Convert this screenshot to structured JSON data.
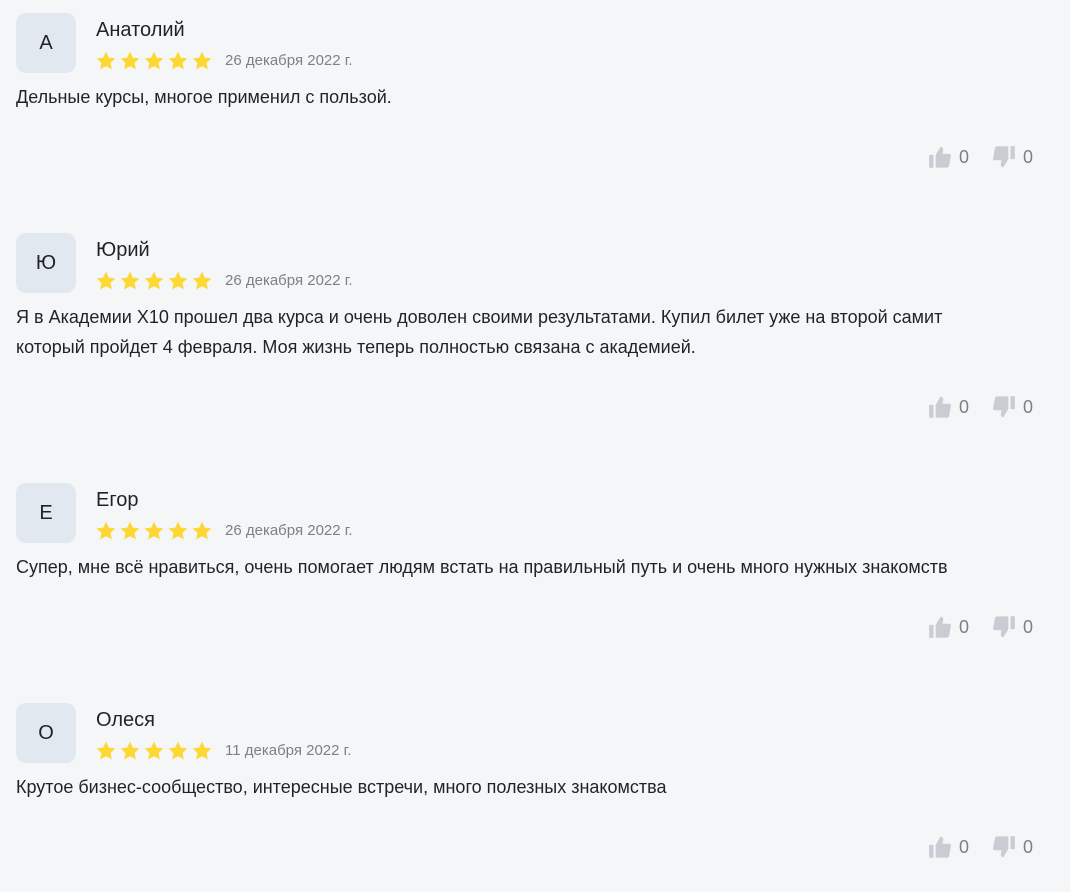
{
  "colors": {
    "background": "#f5f6f8",
    "avatar_bg": "#e2e8f0",
    "star": "#fdd835",
    "text": "#1f2329",
    "muted": "#7b8089",
    "vote_icon": "#c9cdd3"
  },
  "reviews": [
    {
      "initial": "А",
      "author": "Анатолий",
      "rating": 5,
      "date": "26 декабря 2022 г.",
      "text": "Дельные курсы, многое применил с пользой.",
      "likes": "0",
      "dislikes": "0"
    },
    {
      "initial": "Ю",
      "author": "Юрий",
      "rating": 5,
      "date": "26 декабря 2022 г.",
      "text": "Я в Академии X10 прошел два курса и очень доволен своими результатами. Купил билет уже на второй самит который пройдет 4 февраля. Моя жизнь теперь полностью связана с академией.",
      "likes": "0",
      "dislikes": "0"
    },
    {
      "initial": "Е",
      "author": "Егор",
      "rating": 5,
      "date": "26 декабря 2022 г.",
      "text": "Супер, мне всё нравиться, очень помогает людям встать на правильный путь и очень много нужных знакомств",
      "likes": "0",
      "dislikes": "0"
    },
    {
      "initial": "О",
      "author": "Олеся",
      "rating": 5,
      "date": "11 декабря 2022 г.",
      "text": "Крутое бизнес-сообщество, интересные встречи, много полезных знакомства",
      "likes": "0",
      "dislikes": "0"
    }
  ]
}
